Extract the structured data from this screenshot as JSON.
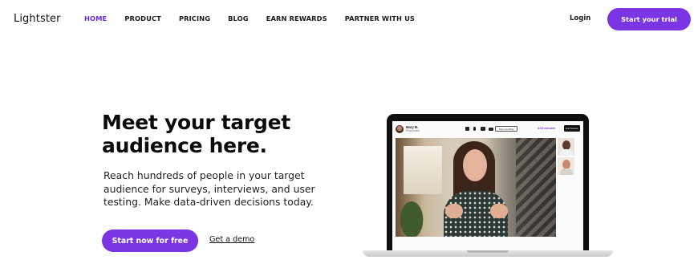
{
  "nav": {
    "logo": "Lightster",
    "links": [
      {
        "label": "HOME",
        "active": true
      },
      {
        "label": "PRODUCT",
        "active": false
      },
      {
        "label": "PRICING",
        "active": false
      },
      {
        "label": "BLOG",
        "active": false
      },
      {
        "label": "EARN REWARDS",
        "active": false
      },
      {
        "label": "PARTNER WITH US",
        "active": false
      }
    ],
    "login_label": "Login",
    "trial_label": "Start your trial"
  },
  "hero": {
    "title": "Meet your target audience here.",
    "subtitle": "Reach hundreds of people in your target audience for surveys, interviews, and user testing. Make data-driven decisions today.",
    "cta_label": "Start now for free",
    "demo_label": "Get a demo"
  },
  "mock_app": {
    "user_name": "Mary B.",
    "user_role": "Respondent",
    "record_label": "Stop recording",
    "timer": "4:03 minutes",
    "end_label": "End Session"
  },
  "colors": {
    "accent": "#7b35e3",
    "active_nav": "#6a2ed8",
    "text": "#111111"
  },
  "icons": [
    "lock-icon",
    "mic-icon",
    "speaker-icon",
    "camera-icon"
  ]
}
